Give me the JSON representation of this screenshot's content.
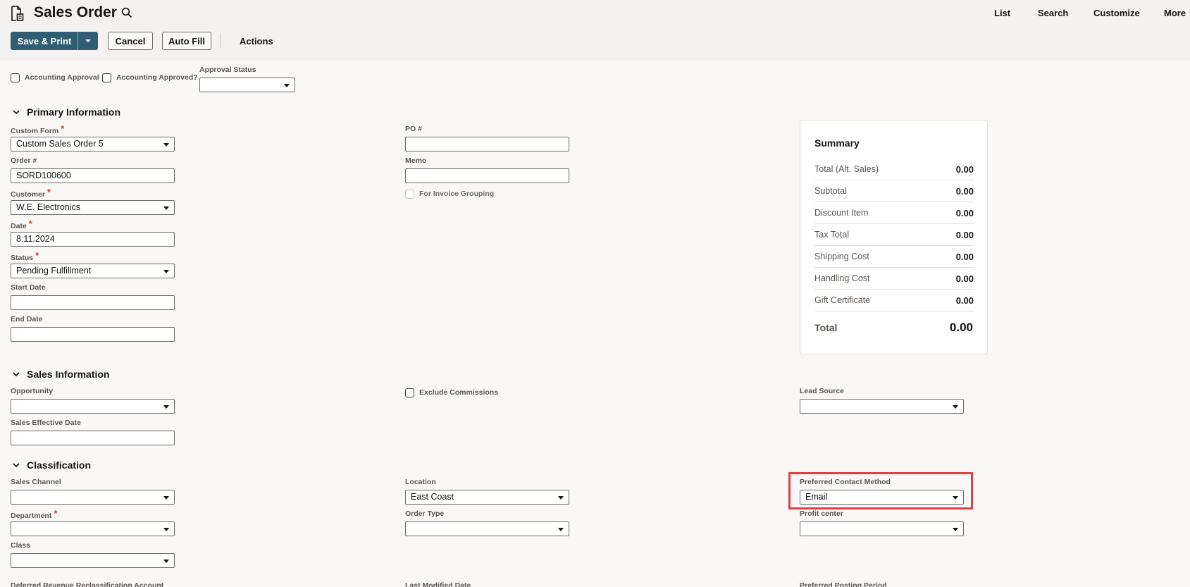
{
  "header": {
    "title": "Sales Order",
    "nav": [
      "List",
      "Search",
      "Customize",
      "More"
    ]
  },
  "toolbar": {
    "save_print": "Save & Print",
    "cancel": "Cancel",
    "auto_fill": "Auto Fill",
    "actions": "Actions"
  },
  "approval": {
    "accounting_approval": "Accounting Approval",
    "accounting_approved": "Accounting Approved?",
    "approval_status_label": "Approval Status",
    "approval_status_value": ""
  },
  "primary": {
    "title": "Primary Information",
    "custom_form_label": "Custom Form",
    "custom_form_value": "Custom Sales Order 5",
    "order_label": "Order #",
    "order_value": "SORD100600",
    "customer_label": "Customer",
    "customer_value": "W.E. Electronics",
    "date_label": "Date",
    "date_value": "8.11.2024",
    "status_label": "Status",
    "status_value": "Pending Fulfillment",
    "start_date_label": "Start Date",
    "start_date_value": "",
    "end_date_label": "End Date",
    "end_date_value": "",
    "po_label": "PO #",
    "po_value": "",
    "memo_label": "Memo",
    "memo_value": "",
    "invoice_grouping_label": "For Invoice Grouping",
    "required_mark": "*"
  },
  "summary": {
    "title": "Summary",
    "rows": [
      {
        "label": "Total (Alt. Sales)",
        "value": "0.00"
      },
      {
        "label": "Subtotal",
        "value": "0.00"
      },
      {
        "label": "Discount Item",
        "value": "0.00"
      },
      {
        "label": "Tax Total",
        "value": "0.00"
      },
      {
        "label": "Shipping Cost",
        "value": "0.00"
      },
      {
        "label": "Handling Cost",
        "value": "0.00"
      },
      {
        "label": "Gift Certificate",
        "value": "0.00"
      }
    ],
    "total_label": "Total",
    "total_value": "0.00"
  },
  "sales": {
    "title": "Sales Information",
    "opportunity_label": "Opportunity",
    "opportunity_value": "",
    "sales_effective_date_label": "Sales Effective Date",
    "sales_effective_date_value": "",
    "exclude_commissions_label": "Exclude Commissions",
    "lead_source_label": "Lead Source",
    "lead_source_value": ""
  },
  "classification": {
    "title": "Classification",
    "sales_channel_label": "Sales Channel",
    "sales_channel_value": "",
    "department_label": "Department",
    "department_value": "",
    "class_label": "Class",
    "class_value": "",
    "location_label": "Location",
    "location_value": "East Coast",
    "order_type_label": "Order Type",
    "order_type_value": "",
    "preferred_contact_label": "Preferred Contact Method",
    "preferred_contact_value": "Email",
    "profit_center_label": "Profit center",
    "profit_center_value": "",
    "deferred_revenue_label": "Deferred Revenue Reclassification Account",
    "last_modified_label": "Last Modified Date",
    "preferred_posting_label": "Preferred Posting Period"
  },
  "colors": {
    "primary_button": "#2f5e74",
    "required": "#c74634",
    "highlight": "#e0403f"
  }
}
